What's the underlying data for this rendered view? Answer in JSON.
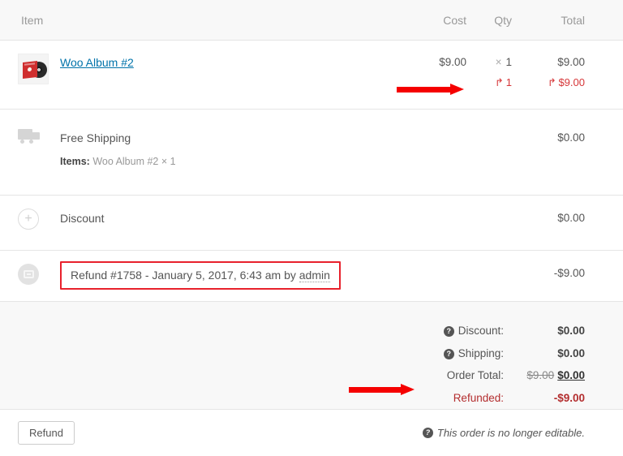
{
  "table_header": {
    "item": "Item",
    "cost": "Cost",
    "qty": "Qty",
    "total": "Total"
  },
  "line_items": [
    {
      "type": "product",
      "thumbnail_icon": "album-thumbnail",
      "name": "Woo Album #2",
      "cost": "$9.00",
      "qty_symbol": "×",
      "qty": "1",
      "total": "$9.00",
      "refund_qty": "1",
      "refund_total": "$9.00"
    },
    {
      "type": "shipping",
      "icon": "truck-icon",
      "name": "Free Shipping",
      "items_label": "Items:",
      "items_value": "Woo Album #2 × 1",
      "total": "$0.00"
    },
    {
      "type": "discount",
      "icon": "plus-circle-icon",
      "name": "Discount",
      "total": "$0.00"
    },
    {
      "type": "refund",
      "icon": "refund-circle-icon",
      "note_prefix": "Refund #1758 - January 5, 2017, 6:43 am by ",
      "note_author": "admin",
      "total": "-$9.00"
    }
  ],
  "totals": {
    "rows": [
      {
        "label": "Discount:",
        "help": true,
        "value": "$0.00"
      },
      {
        "label": "Shipping:",
        "help": true,
        "value": "$0.00"
      },
      {
        "label": "Order Total:",
        "help": false,
        "value_struck": "$9.00",
        "value": "$0.00"
      },
      {
        "label": "Refunded:",
        "help": false,
        "value": "-$9.00",
        "highlight": true
      }
    ]
  },
  "footer": {
    "refund_button": "Refund",
    "note": "This order is no longer editable."
  },
  "colors": {
    "annotation_red": "#f50000",
    "refund_red": "#b32d2e",
    "link_blue": "#0073aa",
    "panel_bg": "#f8f8f8"
  }
}
